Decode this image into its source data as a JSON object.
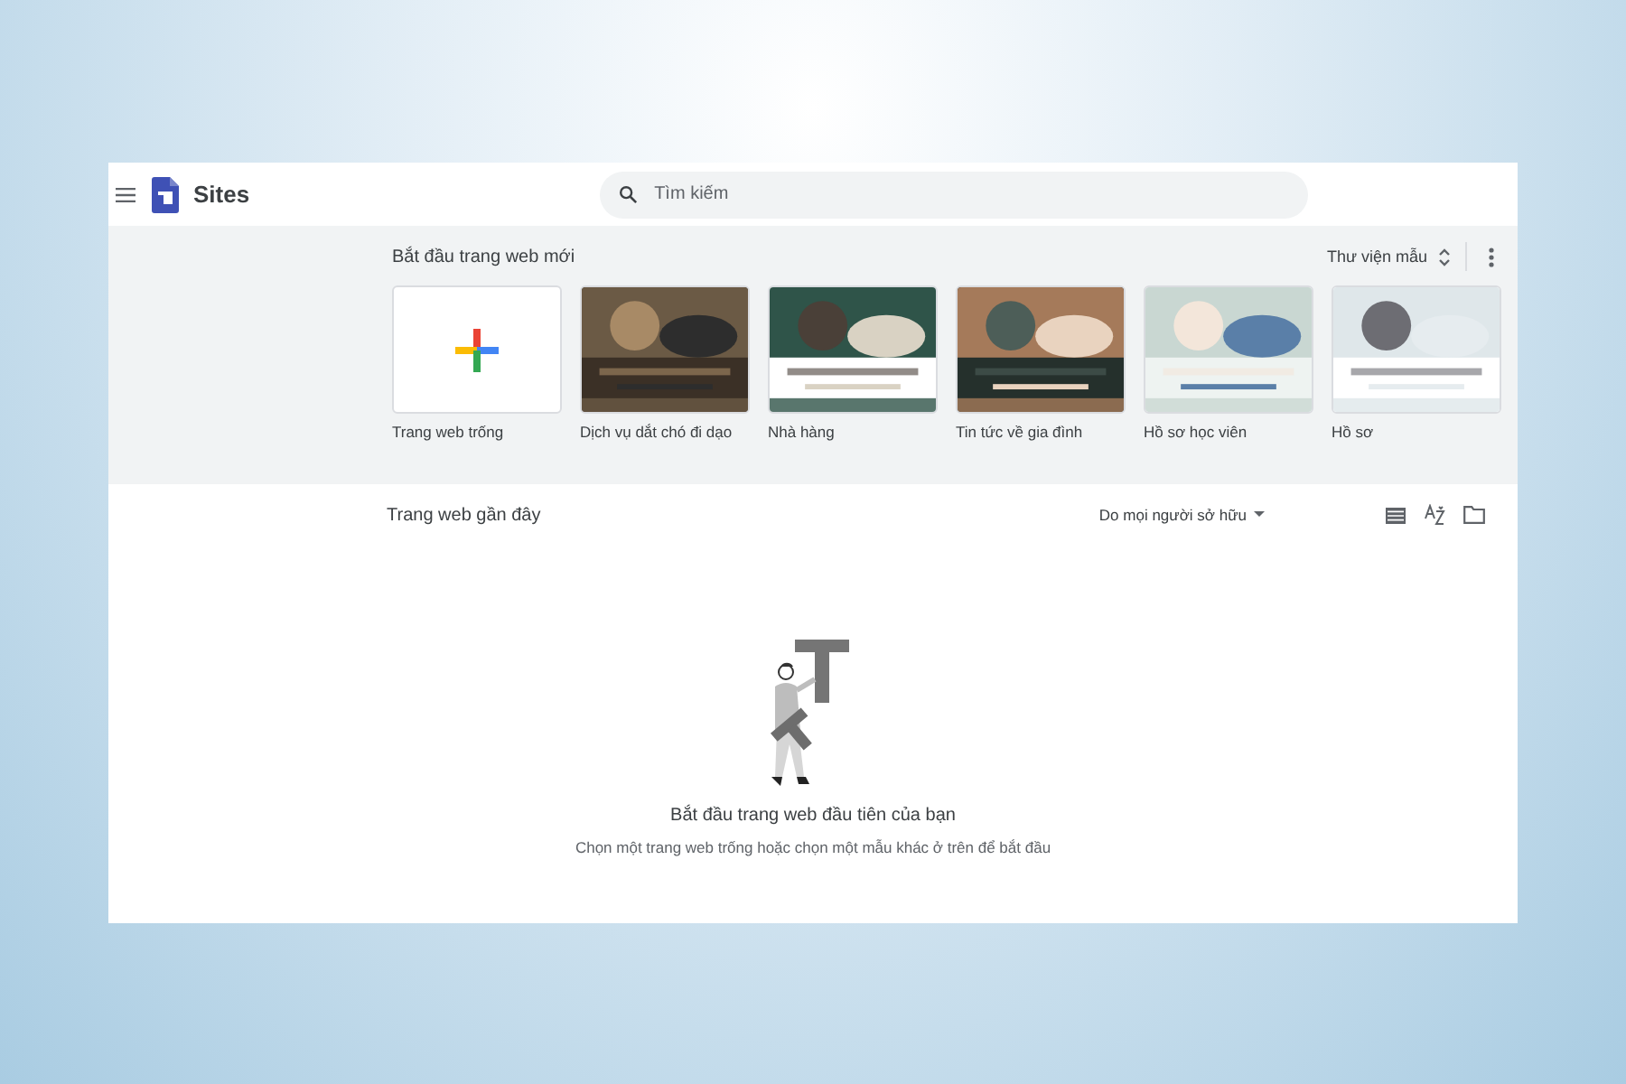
{
  "app": {
    "name": "Sites"
  },
  "search": {
    "placeholder": "Tìm kiếm"
  },
  "gallery": {
    "title": "Bắt đầu trang web mới",
    "library_label": "Thư viện mẫu",
    "templates": [
      {
        "label": "Trang web trống",
        "kind": "blank"
      },
      {
        "label": "Dịch vụ dắt chó đi dạo",
        "kind": "picture"
      },
      {
        "label": "Nhà hàng",
        "kind": "picture"
      },
      {
        "label": "Tin tức về gia đình",
        "kind": "picture"
      },
      {
        "label": "Hồ sơ học viên",
        "kind": "picture"
      },
      {
        "label": "Hồ sơ",
        "kind": "picture"
      }
    ]
  },
  "recent": {
    "title": "Trang web gần đây",
    "owner_filter": "Do mọi người sở hữu",
    "empty_title": "Bắt đầu trang web đầu tiên của bạn",
    "empty_hint": "Chọn một trang web trống hoặc chọn một mẫu khác ở trên để bắt đầu"
  }
}
